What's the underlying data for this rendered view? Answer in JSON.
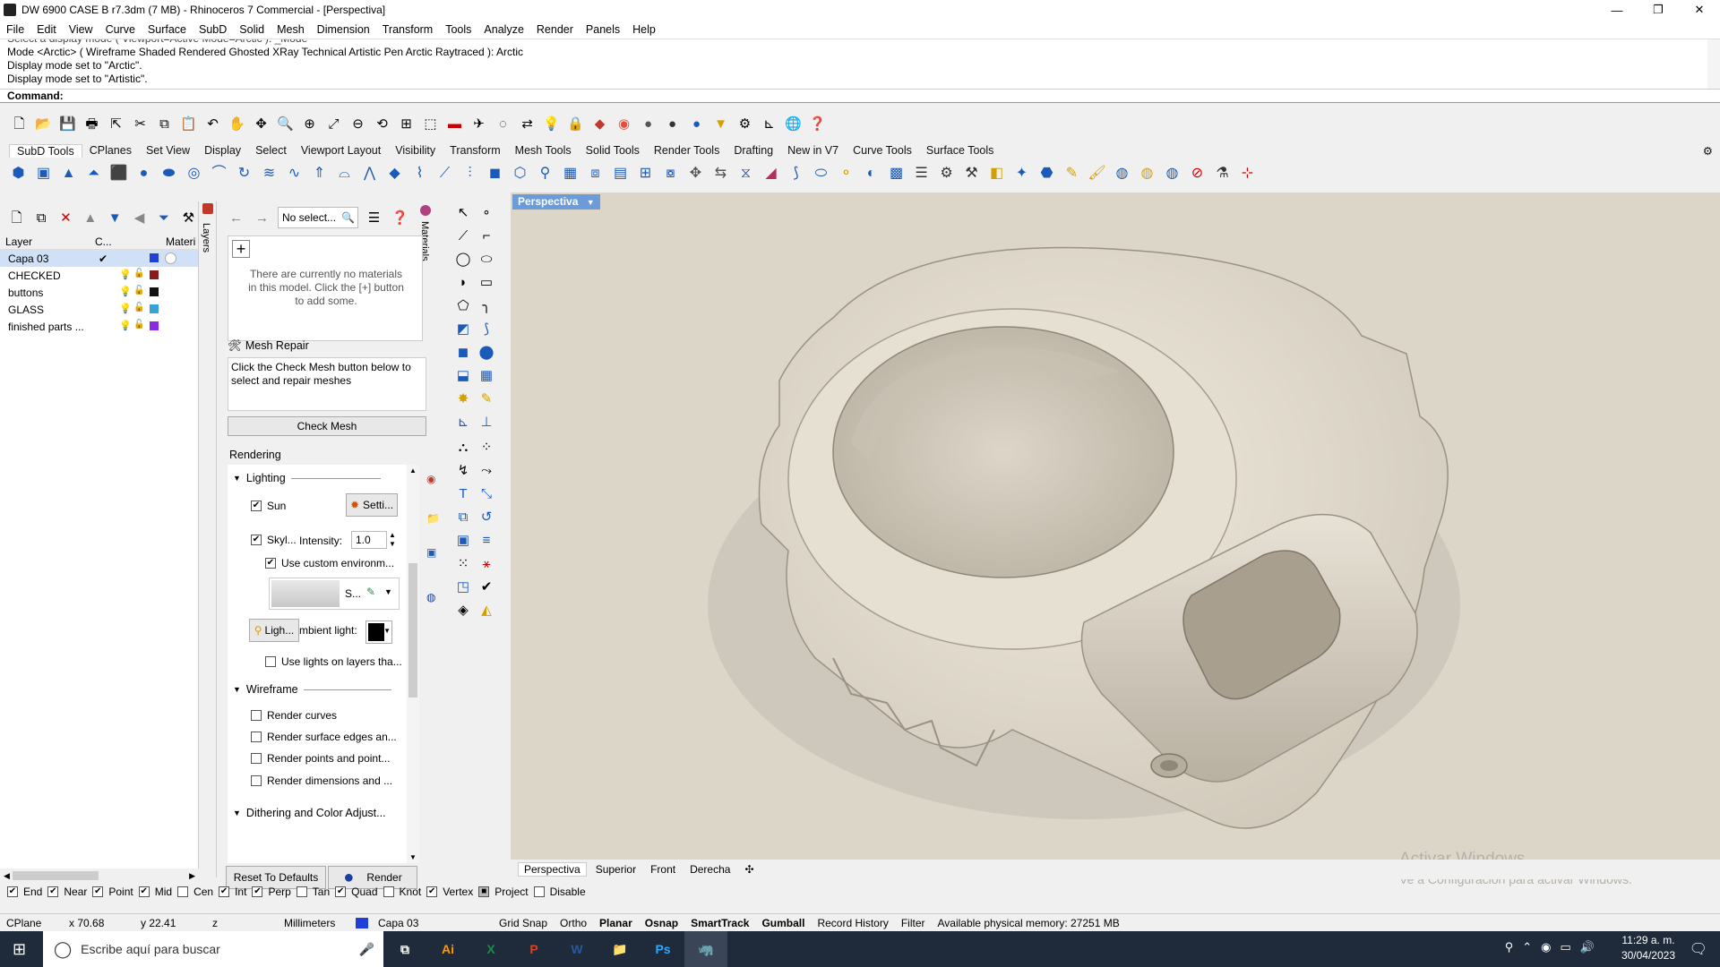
{
  "window": {
    "title": "DW 6900 CASE B r7.3dm (7 MB) - Rhinoceros 7 Commercial - [Perspectiva]",
    "minimize": "—",
    "maximize": "❐",
    "close": "✕"
  },
  "menu": [
    "File",
    "Edit",
    "View",
    "Curve",
    "Surface",
    "SubD",
    "Solid",
    "Mesh",
    "Dimension",
    "Transform",
    "Tools",
    "Analyze",
    "Render",
    "Panels",
    "Help"
  ],
  "command": {
    "history_partial": "Select a display mode ( Viewport=Active  Mode=Arctic ): _Mode",
    "history": [
      "Mode <Arctic> ( Wireframe  Shaded  Rendered  Ghosted  XRay  Technical  Artistic  Pen  Arctic  Raytraced ): Arctic",
      "Display mode set to \"Arctic\".",
      "Display mode set to \"Artistic\"."
    ],
    "prompt": "Command:"
  },
  "toolbar_tabs": [
    "SubD Tools",
    "CPlanes",
    "Set View",
    "Display",
    "Select",
    "Viewport Layout",
    "Visibility",
    "Transform",
    "Mesh Tools",
    "Solid Tools",
    "Render Tools",
    "Drafting",
    "New in V7",
    "Curve Tools",
    "Surface Tools"
  ],
  "layers": {
    "panel_tab": "Layers",
    "columns": [
      "Layer",
      "C...",
      "Materi"
    ],
    "rows": [
      {
        "name": "Capa 03",
        "current": "✔",
        "color": "#1f3fd6",
        "selected": true
      },
      {
        "name": "CHECKED",
        "current": "",
        "color": "#8b1a1a",
        "selected": false
      },
      {
        "name": "buttons",
        "current": "",
        "color": "#111111",
        "selected": false
      },
      {
        "name": "GLASS",
        "current": "",
        "color": "#3aa0d8",
        "selected": false
      },
      {
        "name": "finished parts ...",
        "current": "",
        "color": "#8a2be2",
        "selected": false
      }
    ]
  },
  "materials": {
    "panel_tab": "Materials",
    "search_placeholder": "No select...",
    "add_label": "+",
    "empty_message": "There are currently no materials in this model. Click the [+] button to add some."
  },
  "mesh_repair": {
    "title": "Mesh Repair",
    "message": "Click the Check Mesh button below to select and repair meshes",
    "button": "Check Mesh"
  },
  "rendering": {
    "title": "Rendering",
    "lighting": {
      "title": "Lighting",
      "sun_label": "Sun",
      "sun_checked": true,
      "settings_button": "Setti...",
      "skylight_label": "Skyl...",
      "skylight_checked": true,
      "intensity_label": "Intensity:",
      "intensity_value": "1.0",
      "custom_env_label": "Use custom environm...",
      "custom_env_checked": true,
      "env_short": "S...",
      "lights_button": "Ligh...",
      "ambient_label": "mbient light:",
      "use_layer_lights_label": "Use lights on layers tha...",
      "use_layer_lights_checked": false
    },
    "wireframe": {
      "title": "Wireframe",
      "options": [
        {
          "label": "Render curves",
          "checked": false
        },
        {
          "label": "Render surface edges an...",
          "checked": false
        },
        {
          "label": "Render points and point...",
          "checked": false
        },
        {
          "label": "Render dimensions and ...",
          "checked": false
        }
      ]
    },
    "dithering_title": "Dithering and Color Adjust...",
    "reset_button": "Reset To Defaults",
    "render_button": "Render"
  },
  "viewport": {
    "active_title": "Perspectiva",
    "tabs": [
      "Perspectiva",
      "Superior",
      "Front",
      "Derecha"
    ],
    "add_tab": "✣",
    "watermark_line1": "Activar Windows",
    "watermark_line2": "Ve a Configuración para activar Windows."
  },
  "osnap": [
    {
      "label": "End",
      "checked": true
    },
    {
      "label": "Near",
      "checked": true
    },
    {
      "label": "Point",
      "checked": true
    },
    {
      "label": "Mid",
      "checked": true
    },
    {
      "label": "Cen",
      "checked": false
    },
    {
      "label": "Int",
      "checked": true
    },
    {
      "label": "Perp",
      "checked": true
    },
    {
      "label": "Tan",
      "checked": false
    },
    {
      "label": "Quad",
      "checked": true
    },
    {
      "label": "Knot",
      "checked": false
    },
    {
      "label": "Vertex",
      "checked": true
    },
    {
      "label": "Project",
      "checked": true
    },
    {
      "label": "Disable",
      "checked": false
    }
  ],
  "status": {
    "cplane": "CPlane",
    "x": "x 70.68",
    "y": "y 22.41",
    "z": "z",
    "units": "Millimeters",
    "layer": "Capa 03",
    "layer_color": "#1f3fd6",
    "grid_snap": "Grid Snap",
    "ortho": "Ortho",
    "planar": "Planar",
    "osnap": "Osnap",
    "smarttrack": "SmartTrack",
    "gumball": "Gumball",
    "record_history": "Record History",
    "filter": "Filter",
    "memory": "Available physical memory: 27251 MB"
  },
  "taskbar": {
    "search_placeholder": "Escribe aquí para buscar",
    "apps": [
      "Ai",
      "X",
      "P",
      "W",
      "📁",
      "Ps",
      "🦏"
    ],
    "time": "11:29 a. m.",
    "date": "30/04/2023"
  },
  "colors": {
    "viewport_bg": "#dcd6c9",
    "active_viewport_tab": "#6b9bd8",
    "selected_layer": "#cfe0f7"
  }
}
